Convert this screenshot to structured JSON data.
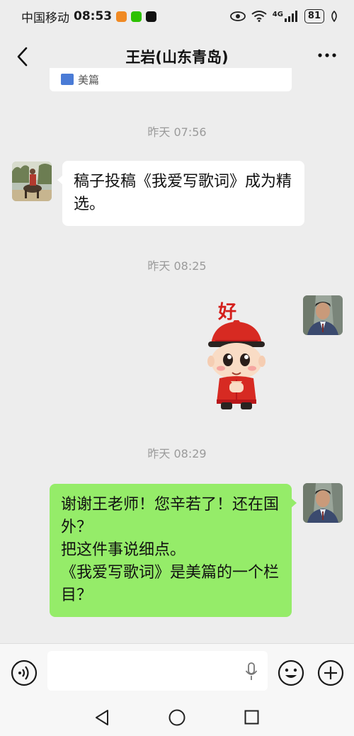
{
  "status_bar": {
    "carrier": "中国移动",
    "time": "08:53",
    "network": "4G",
    "battery": "81"
  },
  "nav": {
    "title": "王岩(山东青岛)"
  },
  "prev_card": {
    "text": "美篇"
  },
  "messages": [
    {
      "timestamp": "昨天 07:56"
    },
    {
      "text": "稿子投稿《我爱写歌词》成为精选。"
    },
    {
      "timestamp": "昨天 08:25"
    },
    {
      "sticker_label": "好"
    },
    {
      "timestamp": "昨天 08:29"
    },
    {
      "lines": [
        "谢谢王老师！您辛若了！还在国外？",
        "把这件事说细点。",
        "《我爱写歌词》是美篇的一个栏目？"
      ]
    }
  ],
  "colors": {
    "background": "#ededed",
    "outgoing_bubble": "#95ec69",
    "incoming_bubble": "#ffffff",
    "timestamp_text": "#9a9a9a"
  },
  "icons": {
    "back": "chevron-left-icon",
    "more": "more-dots-icon",
    "voice": "voice-icon",
    "mic": "mic-icon",
    "emoji": "emoji-icon",
    "plus": "plus-icon"
  }
}
